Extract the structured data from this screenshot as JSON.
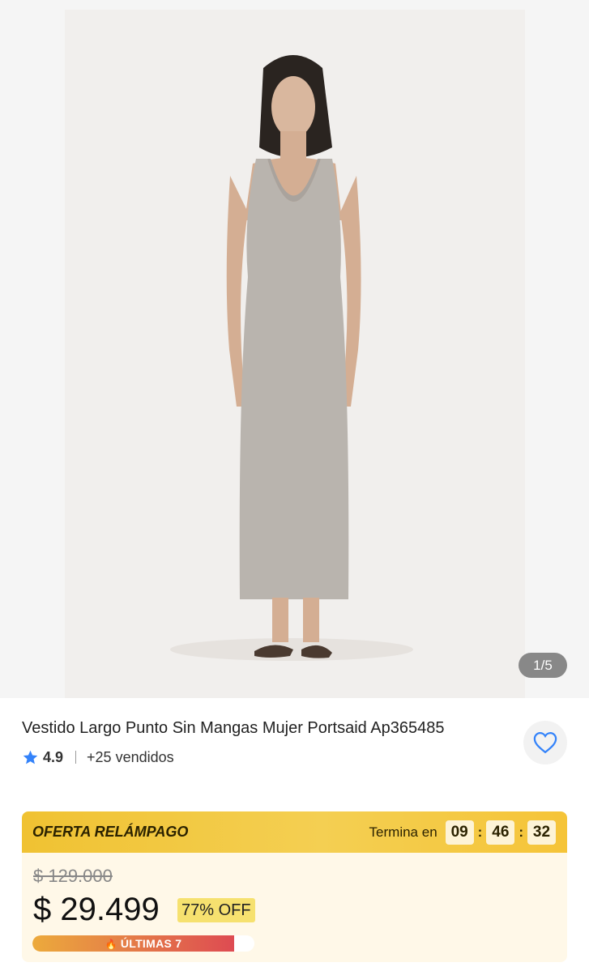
{
  "gallery": {
    "counter": "1/5",
    "image_alt": "Vestido largo gris sin mangas"
  },
  "product": {
    "title": "Vestido Largo Punto Sin Mangas Mujer Portsaid Ap365485",
    "rating": "4.9",
    "sold": "+25 vendidos"
  },
  "deal": {
    "label": "OFERTA RELÁMPAGO",
    "ends_label": "Termina en",
    "hours": "09",
    "minutes": "46",
    "seconds": "32",
    "old_price": "$ 129.000",
    "price": "$ 29.499",
    "discount": "77% OFF",
    "stock_label": "ÚLTIMAS 7",
    "stock_fraction": 0.91
  },
  "colors": {
    "accent": "#3483fa",
    "deal_yellow": "#f4cf52",
    "stock_red": "#de4b52"
  },
  "icons": {
    "rating": "star-icon",
    "favorite": "heart-icon",
    "stock": "flame-icon"
  }
}
